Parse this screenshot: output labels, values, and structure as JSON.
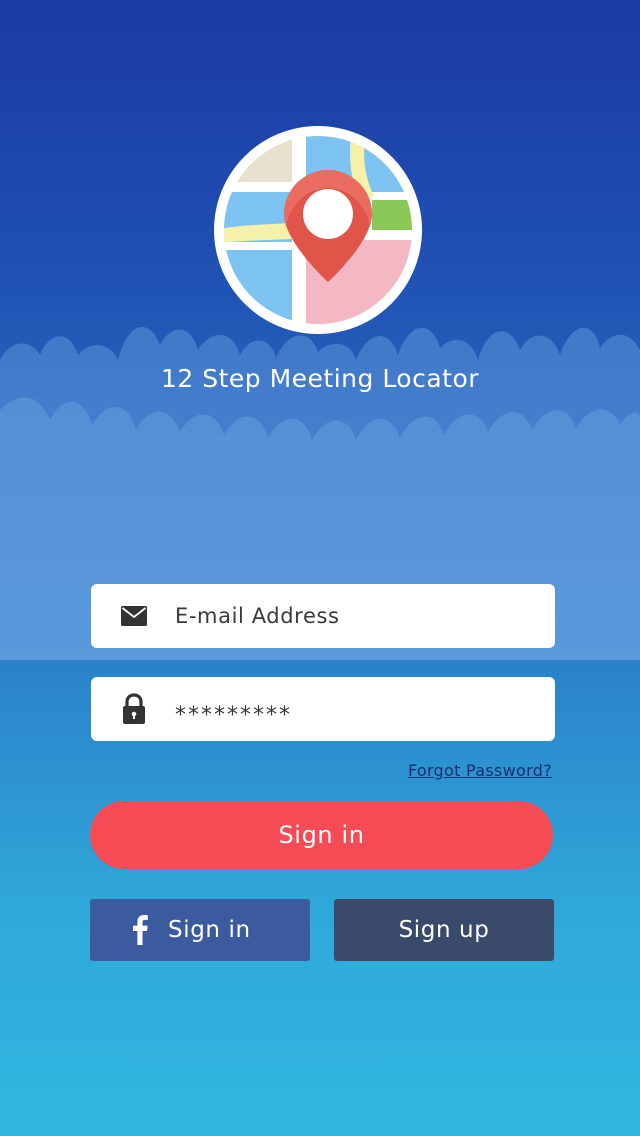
{
  "app": {
    "title": "12 Step Meeting Locator"
  },
  "form": {
    "email_placeholder": "E-mail Address",
    "password_value": "*********",
    "forgot_label": "Forgot Password?",
    "signin_label": "Sign in",
    "facebook_signin_label": "Sign in",
    "signup_label": "Sign up"
  },
  "icons": {
    "logo": "map-pin-logo",
    "email": "envelope-icon",
    "password": "lock-icon",
    "facebook": "facebook-icon"
  },
  "colors": {
    "primary_button": "#f44b55",
    "facebook_button": "#3c5a9e",
    "signup_button": "#394a6b",
    "link": "#14306f"
  }
}
